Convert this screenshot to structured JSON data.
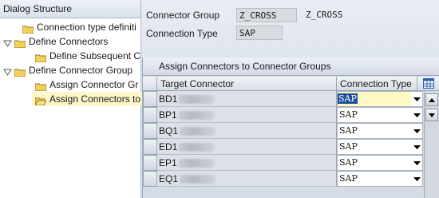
{
  "tree": {
    "header": "Dialog Structure",
    "nodes": [
      {
        "label": "Connection type definiti",
        "level": 1,
        "expander": "none",
        "folder": "closed"
      },
      {
        "label": "Define Connectors",
        "level": 0,
        "expander": "open",
        "folder": "closed"
      },
      {
        "label": "Define Subsequent C",
        "level": 2,
        "expander": "none",
        "folder": "closed"
      },
      {
        "label": "Define Connector Group",
        "level": 0,
        "expander": "open",
        "folder": "closed"
      },
      {
        "label": "Assign Connector Gr",
        "level": 2,
        "expander": "none",
        "folder": "closed"
      },
      {
        "label": "Assign Connectors to",
        "level": 2,
        "expander": "none",
        "folder": "open",
        "selected": true
      }
    ]
  },
  "header": {
    "group_label": "Connector Group",
    "group_value": "Z_CROSS",
    "group_text": "Z_CROSS",
    "type_label": "Connection Type",
    "type_value": "SAP"
  },
  "grid": {
    "title": "Assign Connectors to Connector Groups",
    "columns": [
      "Target Connector",
      "Connection Type"
    ],
    "settings_icon": "table-settings-icon",
    "rows": [
      {
        "connector": "BD1",
        "type": "SAP",
        "focused": true
      },
      {
        "connector": "BP1",
        "type": "SAP"
      },
      {
        "connector": "BQ1",
        "type": "SAP"
      },
      {
        "connector": "ED1",
        "type": "SAP"
      },
      {
        "connector": "EP1",
        "type": "SAP"
      },
      {
        "connector": "EQ1",
        "type": "SAP"
      }
    ]
  },
  "colors": {
    "selection": "#1f4f9c",
    "focus_bg": "#fff9c4",
    "folder": "#f1d15b"
  }
}
